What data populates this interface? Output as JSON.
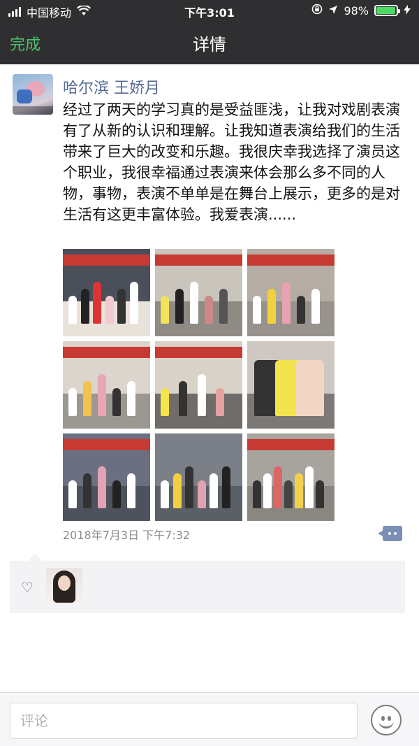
{
  "status_bar": {
    "carrier": "中国移动",
    "time": "下午3:01",
    "battery_percent": "98%",
    "battery_level": 0.98
  },
  "nav": {
    "done_label": "完成",
    "title": "详情"
  },
  "post": {
    "author": "哈尔滨 王娇月",
    "text": "经过了两天的学习真的是受益匪浅，让我对戏剧表演有了从新的认识和理解。让我知道表演给我们的生活带来了巨大的改变和乐趣。我很庆幸我选择了演员这个职业，我很幸福通过表演来体会那么多不同的人物，事物，表演不单单是在舞台上展示，更多的是对生活有这更丰富体验。我爱表演......",
    "timestamp": "2018年7月3日 下午7:32",
    "photos": [
      {
        "icon": "photo-group"
      },
      {
        "icon": "photo-hug"
      },
      {
        "icon": "photo-activity"
      },
      {
        "icon": "photo-room"
      },
      {
        "icon": "photo-hug-2"
      },
      {
        "icon": "photo-closeup"
      },
      {
        "icon": "photo-exercise"
      },
      {
        "icon": "photo-hall"
      },
      {
        "icon": "photo-audience"
      }
    ]
  },
  "likes": {
    "icon": "heart-icon"
  },
  "comment_bar": {
    "placeholder": "评论"
  },
  "colors": {
    "nav_bg": "#2f2f31",
    "accent_green": "#4cc46a",
    "name_blue": "#576b95"
  }
}
